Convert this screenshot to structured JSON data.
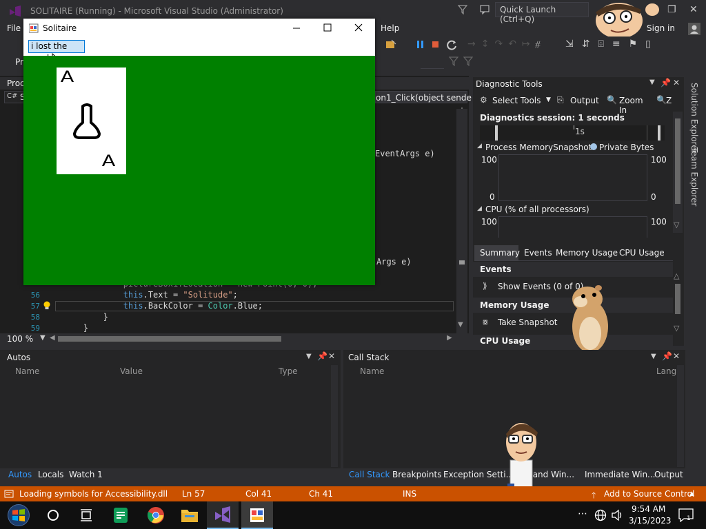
{
  "window": {
    "title": "SOLITAIRE (Running) - Microsoft Visual Studio  (Administrator)",
    "quick_launch_placeholder": "Quick Launch (Ctrl+Q)",
    "sign_in": "Sign in"
  },
  "menu": {
    "file": "File",
    "help": "Help",
    "pr": "Pr"
  },
  "editor": {
    "proc_label": "Proc",
    "doc_tab": "S",
    "method_dropdown": "on1_Click(object sende",
    "frag_eventargs_1": "EventArgs e)",
    "frag_eventargs_2": "Args e)",
    "zoom": "100 %",
    "lines": [
      {
        "num": "",
        "text": "            pictureBox1.Location = new Point(0, 0);"
      },
      {
        "num": "56",
        "pre": "            ",
        "kw": "this",
        "mid": ".Text = ",
        "str": "\"Solitude\"",
        "post": ";"
      },
      {
        "num": "57",
        "pre": "            ",
        "kw": "this",
        "mid": ".BackColor = ",
        "type": "Color",
        "post": ".Blue;"
      },
      {
        "num": "58",
        "text": "        }"
      },
      {
        "num": "59",
        "text": "    }"
      }
    ]
  },
  "solitaire": {
    "title": "Solitaire",
    "button_label": "i lost the card",
    "card_rank_top": "A",
    "card_rank_bottom": "A"
  },
  "diagnostics": {
    "title": "Diagnostic Tools",
    "select_tools": "Select Tools",
    "output": "Output",
    "zoom_in": "Zoom In",
    "zoom_cut": "Z",
    "session": "Diagnostics session: 1 seconds",
    "timeline_tick": "1s",
    "process_memory": "Process Memory",
    "snapshot": "Snapshot",
    "private_bytes": "Private Bytes",
    "mem_max": "100",
    "mem_min": "0",
    "mem_max_r": "100",
    "mem_min_r": "0",
    "cpu_title": "CPU (% of all processors)",
    "cpu_max": "100",
    "cpu_max_r": "100",
    "tabs": [
      "Summary",
      "Events",
      "Memory Usage",
      "CPU Usage"
    ],
    "events_header": "Events",
    "show_events": "Show Events (0 of 0)",
    "memory_usage_header": "Memory Usage",
    "take_snapshot": "Take Snapshot",
    "cpu_usage_header": "CPU Usage"
  },
  "side_tabs": {
    "solution_explorer": "Solution Explorer",
    "team_explorer": "Team Explorer"
  },
  "autos": {
    "title": "Autos",
    "col_name": "Name",
    "col_value": "Value",
    "col_type": "Type",
    "tabs": [
      "Autos",
      "Locals",
      "Watch 1"
    ]
  },
  "callstack": {
    "title": "Call Stack",
    "col_name": "Name",
    "col_lang": "Lang",
    "tabs": [
      "Call Stack",
      "Breakpoints",
      "Exception Setti...",
      "mand Win...",
      "Immediate Win...",
      "Output"
    ]
  },
  "status": {
    "message": "Loading symbols for Accessibility.dll",
    "ln": "Ln 57",
    "col": "Col 41",
    "ch": "Ch 41",
    "ins": "INS",
    "source_control": "Add to Source Control"
  },
  "taskbar": {
    "time": "9:54 AM",
    "date": "3/15/2023",
    "more": "⋯"
  },
  "colors": {
    "vs_bg": "#2d2d30",
    "editor_bg": "#1e1e1e",
    "status_orange": "#ca5100",
    "solitaire_green": "#008000",
    "keyword_blue": "#569cd6",
    "string_orange": "#d69d85",
    "type_teal": "#4ec9b0",
    "accent_blue": "#3399ff"
  }
}
